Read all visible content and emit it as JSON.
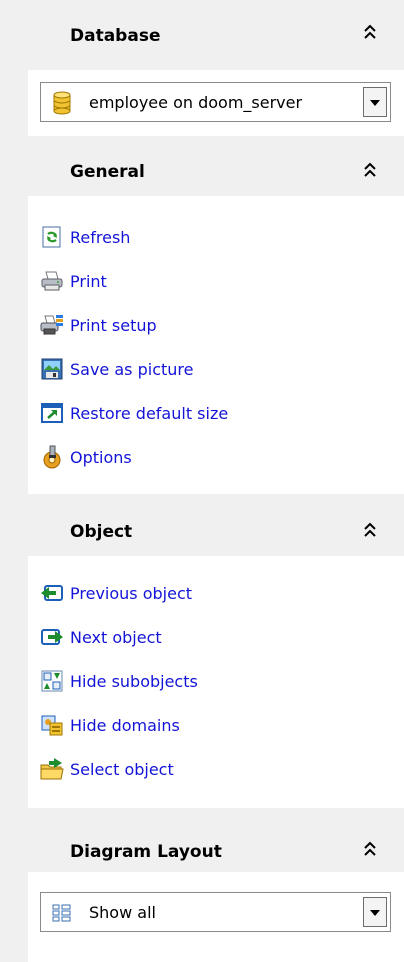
{
  "database": {
    "title": "Database",
    "collapse_icon": "double-chevron-up-icon",
    "selector": {
      "icon": "database-cylinder-icon",
      "value": "employee on doom_server"
    }
  },
  "general": {
    "title": "General",
    "collapse_icon": "double-chevron-up-icon",
    "items": [
      {
        "label": "Refresh",
        "icon": "refresh-icon"
      },
      {
        "label": "Print",
        "icon": "printer-icon"
      },
      {
        "label": "Print setup",
        "icon": "print-setup-icon"
      },
      {
        "label": "Save as picture",
        "icon": "save-picture-icon"
      },
      {
        "label": "Restore default size",
        "icon": "restore-size-icon"
      },
      {
        "label": "Options",
        "icon": "options-icon"
      }
    ]
  },
  "object": {
    "title": "Object",
    "collapse_icon": "double-chevron-up-icon",
    "items": [
      {
        "label": "Previous object",
        "icon": "arrow-left-icon"
      },
      {
        "label": "Next object",
        "icon": "arrow-right-icon"
      },
      {
        "label": "Hide subobjects",
        "icon": "hide-subobjects-icon"
      },
      {
        "label": "Hide domains",
        "icon": "hide-domains-icon"
      },
      {
        "label": "Select object",
        "icon": "select-object-folder-icon"
      }
    ]
  },
  "diagram_layout": {
    "title": "Diagram Layout",
    "collapse_icon": "double-chevron-up-icon",
    "selector": {
      "icon": "layout-grid-icon",
      "value": "Show all"
    }
  },
  "colors": {
    "link": "#1414d8",
    "panel_bg": "#ffffff",
    "sidebar_bg": "#f0f0f0"
  }
}
